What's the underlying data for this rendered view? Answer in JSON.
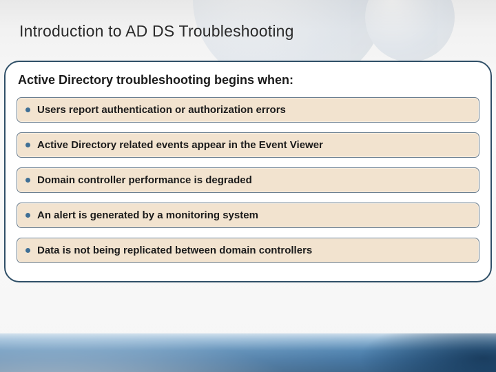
{
  "title": "Introduction to AD DS Troubleshooting",
  "panel": {
    "heading": "Active Directory troubleshooting begins when:",
    "items": [
      "Users report authentication or authorization errors",
      "Active Directory related events appear in the Event Viewer",
      "Domain controller performance is degraded",
      "An alert is generated by a monitoring system",
      "Data is not being replicated between domain controllers"
    ]
  },
  "colors": {
    "accent": "#3f6f95",
    "panel_border": "#2f4f67",
    "item_bg": "#f2e3cf",
    "footer_gradient_top": "#c7d9e8",
    "footer_gradient_bottom": "#1e4f7b"
  }
}
